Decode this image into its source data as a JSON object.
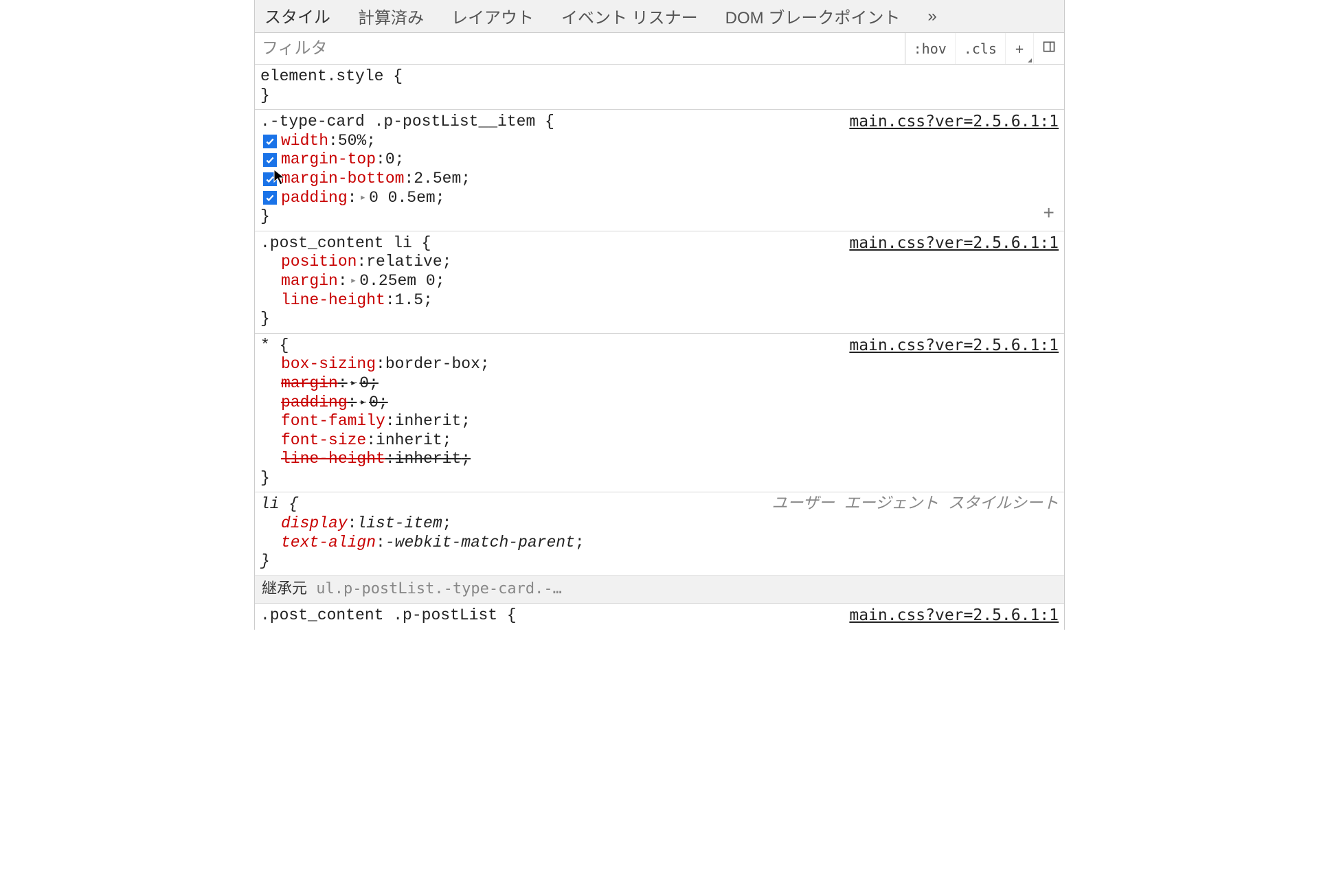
{
  "tabs": {
    "items": [
      "スタイル",
      "計算済み",
      "レイアウト",
      "イベント リスナー",
      "DOM ブレークポイント"
    ],
    "more": "»"
  },
  "toolbar": {
    "filter_placeholder": "フィルタ",
    "hov": ":hov",
    "cls": ".cls"
  },
  "source_link": "main.css?ver=2.5.6.1:1",
  "ua_label": "ユーザー エージェント スタイルシート",
  "inherit_label": "継承元",
  "inherit_selector": "ul.p-postList.-type-card.-…",
  "rules": {
    "r0": {
      "selector": "element.style"
    },
    "r1": {
      "selector": ".-type-card .p-postList__item",
      "d0p": "width",
      "d0v": "50%",
      "d1p": "margin-top",
      "d1v": "0",
      "d2p": "margin-bottom",
      "d2v": "2.5em",
      "d3p": "padding",
      "d3v": "0 0.5em"
    },
    "r2": {
      "selector": ".post_content li",
      "d0p": "position",
      "d0v": "relative",
      "d1p": "margin",
      "d1v": "0.25em 0",
      "d2p": "line-height",
      "d2v": "1.5"
    },
    "r3": {
      "selector": "*",
      "d0p": "box-sizing",
      "d0v": "border-box",
      "d1p": "margin",
      "d1v": "0",
      "d2p": "padding",
      "d2v": "0",
      "d3p": "font-family",
      "d3v": "inherit",
      "d4p": "font-size",
      "d4v": "inherit",
      "d5p": "line-height",
      "d5v": "inherit"
    },
    "r4": {
      "selector": "li",
      "d0p": "display",
      "d0v": "list-item",
      "d1p": "text-align",
      "d1v": "-webkit-match-parent"
    },
    "r5": {
      "selector": ".post_content .p-postList"
    }
  }
}
